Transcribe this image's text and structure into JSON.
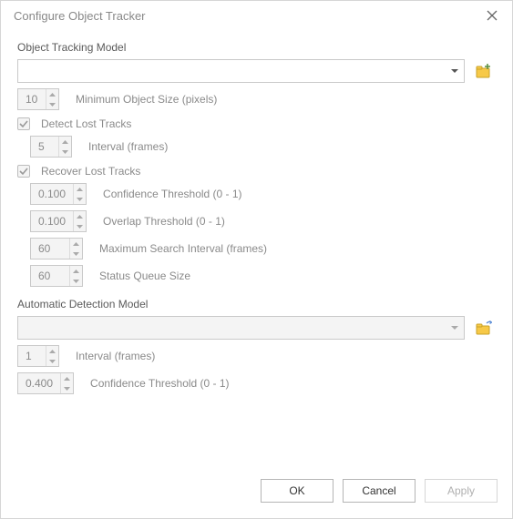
{
  "title": "Configure Object Tracker",
  "model_section_label": "Object Tracking Model",
  "model_value": "",
  "min_size": {
    "value": "10",
    "label": "Minimum Object Size (pixels)"
  },
  "detect_lost": {
    "checked": true,
    "label": "Detect Lost Tracks"
  },
  "detect_interval": {
    "value": "5",
    "label": "Interval (frames)"
  },
  "recover_lost": {
    "checked": true,
    "label": "Recover Lost Tracks"
  },
  "recover": {
    "confidence": {
      "value": "0.100",
      "label": "Confidence Threshold (0 - 1)"
    },
    "overlap": {
      "value": "0.100",
      "label": "Overlap Threshold (0 - 1)"
    },
    "max_search": {
      "value": "60",
      "label": "Maximum Search Interval (frames)"
    },
    "queue": {
      "value": "60",
      "label": "Status Queue Size"
    }
  },
  "auto_section_label": "Automatic Detection Model",
  "auto_model_value": "",
  "auto_interval": {
    "value": "1",
    "label": "Interval (frames)"
  },
  "auto_confidence": {
    "value": "0.400",
    "label": "Confidence Threshold (0 - 1)"
  },
  "buttons": {
    "ok": "OK",
    "cancel": "Cancel",
    "apply": "Apply"
  }
}
